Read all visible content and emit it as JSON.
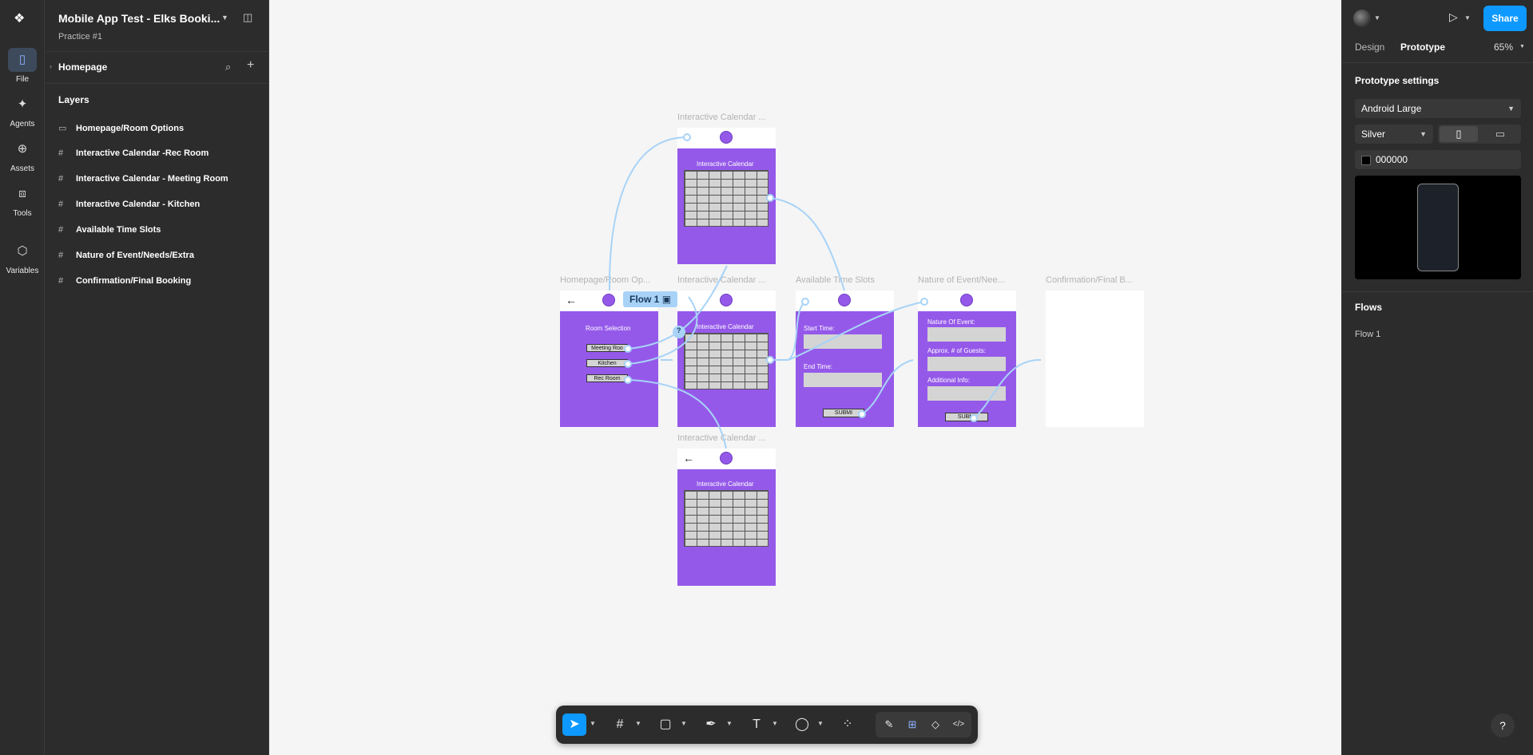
{
  "file": {
    "title": "Mobile App Test - Elks Booki...",
    "subtitle": "Practice #1"
  },
  "rail": [
    {
      "label": "File",
      "icon": "file-icon",
      "glyph": "▯"
    },
    {
      "label": "Agents",
      "icon": "sparkle-icon",
      "glyph": "✦"
    },
    {
      "label": "Assets",
      "icon": "assets-icon",
      "glyph": "⊕"
    },
    {
      "label": "Tools",
      "icon": "toolbox-icon",
      "glyph": "⧈"
    },
    {
      "label": "Variables",
      "icon": "variables-icon",
      "glyph": "⬡"
    }
  ],
  "page": {
    "name": "Homepage"
  },
  "layers_header": "Layers",
  "layers": [
    {
      "name": "Homepage/Room Options",
      "icon": "▭"
    },
    {
      "name": "Interactive Calendar -Rec Room",
      "icon": "#"
    },
    {
      "name": "Interactive Calendar - Meeting Room",
      "icon": "#"
    },
    {
      "name": "Interactive Calendar - Kitchen",
      "icon": "#"
    },
    {
      "name": "Available Time Slots",
      "icon": "#"
    },
    {
      "name": "Nature of Event/Needs/Extra",
      "icon": "#"
    },
    {
      "name": "Confirmation/Final Booking",
      "icon": "#"
    }
  ],
  "canvas": {
    "frame_labels": {
      "top": "Interactive Calendar ...",
      "home": "Homepage/Room Op...",
      "mid": "Interactive Calendar ...",
      "slots": "Available Time Slots",
      "nature": "Nature of Event/Nee...",
      "confirm": "Confirmation/Final B...",
      "bottom": "Interactive Calendar ..."
    },
    "flow_tag": "Flow 1",
    "calendar_heading": "Interactive Calendar",
    "room_selection": "Room Selection",
    "rooms": [
      "Meeting Roo",
      "Kitchen",
      "Rec Room"
    ],
    "start_time": "Start Time:",
    "end_time": "End Time:",
    "submit": "SUBMI",
    "nature_label": "Nature Of Event:",
    "guests_label": "Approx. # of Guests:",
    "info_label": "Additional Info:",
    "question_mark": "?"
  },
  "toolbar": {
    "tools": [
      "move-tool",
      "frame-tool",
      "shape-tool",
      "pen-tool",
      "text-tool",
      "comment-tool",
      "actions-tool"
    ],
    "glyphs": [
      "➤",
      "#",
      "▢",
      "✒",
      "T",
      "◯",
      "⁘"
    ],
    "mode_glyphs": [
      "✎",
      "⊞",
      "◇",
      "</>"
    ]
  },
  "right": {
    "tabs": [
      "Design",
      "Prototype"
    ],
    "active_tab": "Prototype",
    "zoom": "65%",
    "share": "Share",
    "settings_title": "Prototype settings",
    "device": "Android Large",
    "model": "Silver",
    "bg_color_hex": "000000",
    "flows_title": "Flows",
    "flows": [
      "Flow 1"
    ],
    "help": "?"
  },
  "colors": {
    "accent": "#0d99ff",
    "frame": "#9559ea",
    "connector": "#a8d3f7",
    "canvas": "#f5f5f5",
    "panel": "#2c2c2c"
  }
}
